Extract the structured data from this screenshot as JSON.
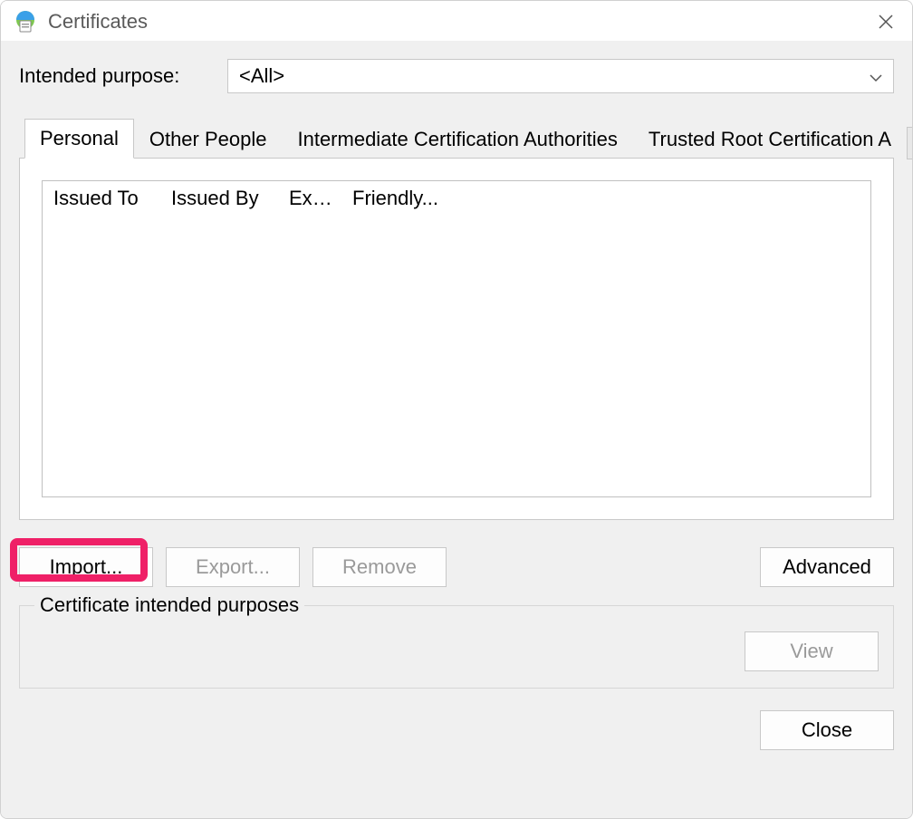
{
  "window": {
    "title": "Certificates"
  },
  "purpose": {
    "label": "Intended purpose:",
    "value": "<All>"
  },
  "tabs": [
    {
      "label": "Personal",
      "active": true
    },
    {
      "label": "Other People",
      "active": false
    },
    {
      "label": "Intermediate Certification Authorities",
      "active": false
    },
    {
      "label": "Trusted Root Certification A",
      "active": false
    }
  ],
  "columns": [
    "Issued To",
    "Issued By",
    "Expi...",
    "Friendly..."
  ],
  "rows": [],
  "buttons": {
    "import": "Import...",
    "export": "Export...",
    "remove": "Remove",
    "advanced": "Advanced",
    "view": "View",
    "close": "Close"
  },
  "groupbox": {
    "label": "Certificate intended purposes"
  },
  "annotation": {
    "highlight_target": "import-button",
    "color": "#ef2067"
  }
}
